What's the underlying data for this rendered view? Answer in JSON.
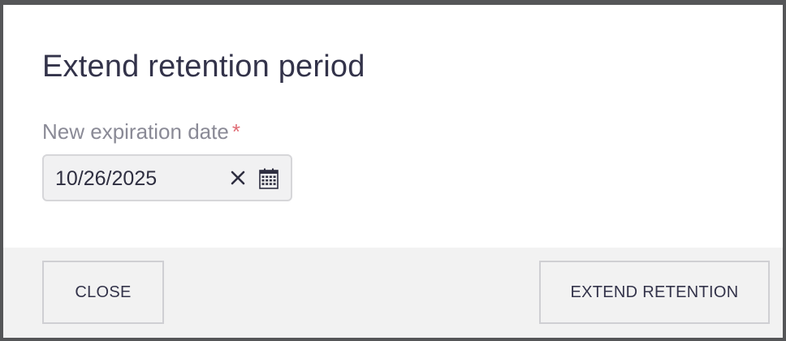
{
  "dialog": {
    "title": "Extend retention period",
    "field": {
      "label": "New expiration date",
      "required_marker": "*",
      "value": "10/26/2025",
      "clear_icon": "close-icon",
      "calendar_icon": "calendar-icon"
    },
    "footer": {
      "close_label": "CLOSE",
      "extend_label": "EXTEND RETENTION"
    }
  },
  "colors": {
    "title": "#33334a",
    "label": "#8a8a96",
    "required": "#e06c75",
    "input_bg": "#f1f1f2",
    "footer_bg": "#f2f2f2",
    "backdrop": "#555658"
  }
}
